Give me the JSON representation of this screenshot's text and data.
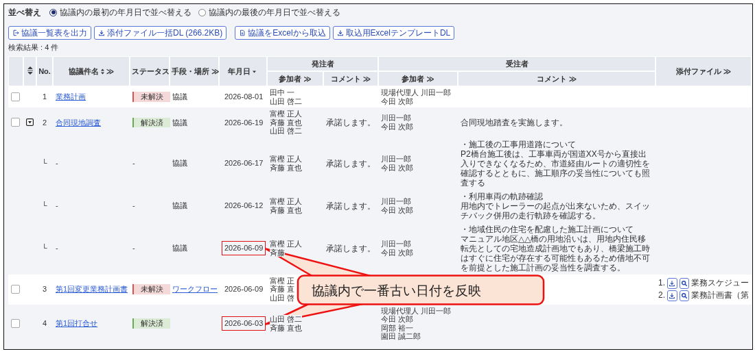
{
  "sort": {
    "label": "並べ替え",
    "options": [
      {
        "label": "協議内の最初の年月日で並べ替える",
        "selected": true
      },
      {
        "label": "協議内の最後の年月日で並べ替える",
        "selected": false
      }
    ]
  },
  "toolbar_groups": [
    [
      {
        "label": "協議一覧表を出力",
        "kind": "export"
      },
      {
        "label": "添付ファイル一括DL (266.2KB)",
        "kind": "download"
      }
    ],
    [
      {
        "label": "協議をExcelから取込",
        "kind": "import"
      },
      {
        "label": "取込用ExcelテンプレートDL",
        "kind": "download"
      }
    ]
  ],
  "result_count": "検索結果 : 4 件",
  "header": {
    "no": "No.",
    "title": {
      "label": "協議件名",
      "sortable": true,
      "more": "≫"
    },
    "status": "ステータス",
    "method": "手段・場所 ≫",
    "date": {
      "label": "年月日",
      "sorted": true
    },
    "owner": {
      "label": "発注者",
      "participants": "参加者 ≫",
      "comment": "コメント ≫"
    },
    "contractor": {
      "label": "受注者",
      "participants": "参加者 ≫",
      "comment": "コメント ≫"
    },
    "attachments": "添付ファイル ≫"
  },
  "rows": [
    {
      "checked": false,
      "no": "1",
      "title": {
        "text": "業務計画",
        "link": true
      },
      "status": {
        "text": "未解決",
        "kind": "unresolved"
      },
      "method": {
        "text": "協議",
        "link": false
      },
      "date": "2026-08-01",
      "highlighted": false,
      "owner_participants": [
        "田中 一",
        "山田 啓二"
      ],
      "contractor_participants": [
        "現場代理人 川田一郎",
        "今田 次郎"
      ]
    },
    {
      "checked": false,
      "no": "2",
      "expanded": true,
      "title": {
        "text": "合同現地調査",
        "link": true
      },
      "status": {
        "text": "解決済",
        "kind": "resolved"
      },
      "method": {
        "text": "協議",
        "link": false
      },
      "date": "2026-06-19",
      "highlighted": false,
      "owner_participants": [
        "富樫 正人",
        "斉藤 直也",
        "山田 啓二"
      ],
      "owner_comment": [
        "承諾します。"
      ],
      "contractor_participants": [
        "川田一郎",
        "今田 次郎"
      ],
      "contractor_comment": [
        "合同現地踏査を実施します。"
      ],
      "children": [
        {
          "marker": "└",
          "title": {
            "text": "-",
            "link": false
          },
          "status": {
            "text": "-",
            "kind": "none"
          },
          "method": {
            "text": "協議",
            "link": false
          },
          "date": "2026-06-17",
          "highlighted": false,
          "owner_participants": [
            "富樫 正人",
            "斉藤 直也"
          ],
          "owner_comment": [
            "承諾します。"
          ],
          "contractor_participants": [
            "川田一郎",
            "今田 次郎"
          ],
          "contractor_comment": [
            "・施工後の工事用道路について",
            "P2橋台施工後は、工事車両が国道XX号から直接出入りできなくなるため、市道経由ルートの適切性を確認するとともに、施工順序の妥当性についても照査する"
          ]
        },
        {
          "marker": "└",
          "title": {
            "text": "-",
            "link": false
          },
          "status": {
            "text": "-",
            "kind": "none"
          },
          "method": {
            "text": "協議",
            "link": false
          },
          "date": "2026-06-12",
          "highlighted": false,
          "owner_participants": [
            "富樫 正人",
            "斉藤 直也"
          ],
          "owner_comment": [
            "承諾します。"
          ],
          "contractor_participants": [
            "川田一郎",
            "今田 次郎"
          ],
          "contractor_comment": [
            "・利用車両の軌跡確認",
            "用地内でトレーラーの起点が出来ないため、スイッチバック併用の走行軌跡を確認する。"
          ]
        },
        {
          "marker": "└",
          "title": {
            "text": "-",
            "link": false
          },
          "status": {
            "text": "-",
            "kind": "none"
          },
          "method": {
            "text": "協議",
            "link": false
          },
          "date": "2026-06-09",
          "highlighted": true,
          "owner_participants": [
            "富樫 正人",
            "斉藤"
          ],
          "owner_comment": [
            "承諾します。"
          ],
          "contractor_participants": [
            "川田一郎",
            "今田 次郎"
          ],
          "contractor_comment": [
            "・地域住民の住宅を配慮した施工計画について",
            "マニュアル地区△△橋の用地沿いは、用地内住民移転先としての宅地造成計画地でもあり、橋梁施工時はすぐに住宅が存在する可能性もあるため借地不可を前提とした施工計画の妥当性を調査する。"
          ]
        }
      ]
    },
    {
      "checked": false,
      "no": "3",
      "title": {
        "text": "第1回変更業務計画書",
        "link": true
      },
      "status": {
        "text": "未解決",
        "kind": "unresolved"
      },
      "method": {
        "text": "ワークフロー",
        "link": true
      },
      "date": "2026-06-09",
      "highlighted": false,
      "owner_participants": [
        "富樫 正",
        "斉藤 直",
        "山田 啓"
      ],
      "attachments": [
        {
          "index": "1.",
          "name": "業務スケジュー"
        },
        {
          "index": "2.",
          "name": "業務計画書（第"
        }
      ]
    },
    {
      "checked": false,
      "no": "4",
      "title": {
        "text": "第1回打合せ",
        "link": true
      },
      "status": {
        "text": "解決済",
        "kind": "resolved"
      },
      "date": "2026-06-03",
      "highlighted": true,
      "owner_participants": [
        "山田 啓二",
        "斉藤 直也"
      ],
      "contractor_participants": [
        "現場代理人 川田一郎",
        "今田 次郎",
        "岡部 裕一",
        "園田 誠二郎"
      ]
    }
  ],
  "callout": {
    "text": "協議内で一番古い日付を反映"
  }
}
